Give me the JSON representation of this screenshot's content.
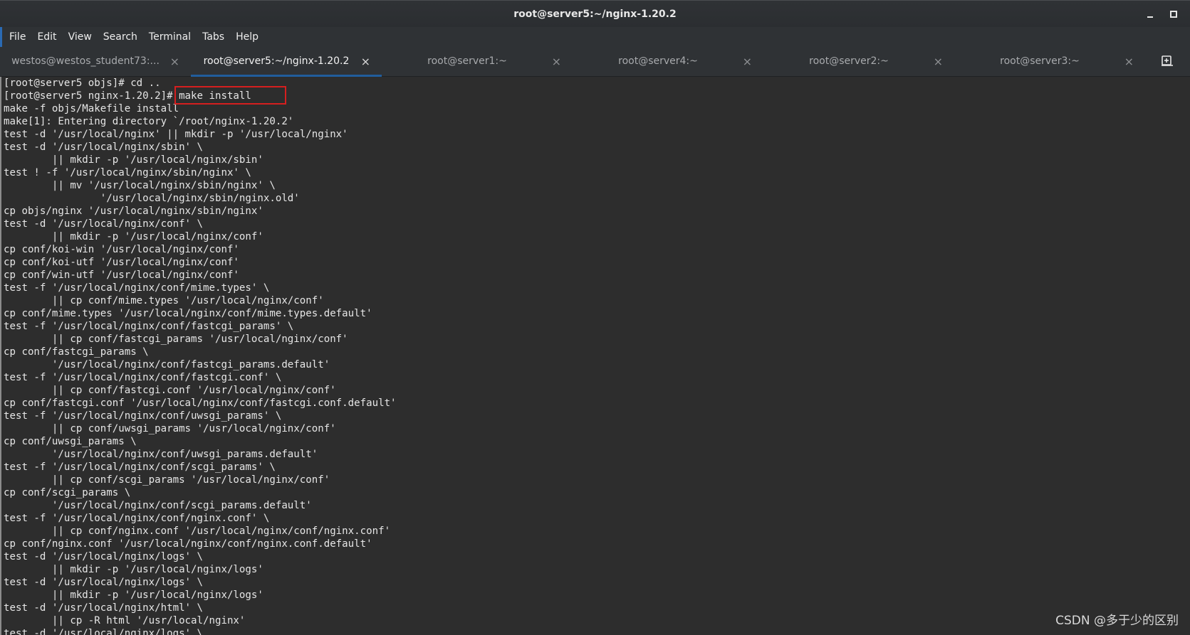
{
  "window": {
    "title": "root@server5:~/nginx-1.20.2"
  },
  "menubar": {
    "items": [
      "File",
      "Edit",
      "View",
      "Search",
      "Terminal",
      "Tabs",
      "Help"
    ]
  },
  "tabs": [
    {
      "label": "westos@westos_student73:...",
      "active": false
    },
    {
      "label": "root@server5:~/nginx-1.20.2",
      "active": true
    },
    {
      "label": "root@server1:~",
      "active": false
    },
    {
      "label": "root@server4:~",
      "active": false
    },
    {
      "label": "root@server2:~",
      "active": false
    },
    {
      "label": "root@server3:~",
      "active": false
    }
  ],
  "tab_close_glyph": "×",
  "terminal": {
    "lines": [
      "[root@server5 objs]# cd ..",
      "[root@server5 nginx-1.20.2]# make install",
      "make -f objs/Makefile install",
      "make[1]: Entering directory `/root/nginx-1.20.2'",
      "test -d '/usr/local/nginx' || mkdir -p '/usr/local/nginx'",
      "test -d '/usr/local/nginx/sbin' \\",
      "        || mkdir -p '/usr/local/nginx/sbin'",
      "test ! -f '/usr/local/nginx/sbin/nginx' \\",
      "        || mv '/usr/local/nginx/sbin/nginx' \\",
      "                '/usr/local/nginx/sbin/nginx.old'",
      "cp objs/nginx '/usr/local/nginx/sbin/nginx'",
      "test -d '/usr/local/nginx/conf' \\",
      "        || mkdir -p '/usr/local/nginx/conf'",
      "cp conf/koi-win '/usr/local/nginx/conf'",
      "cp conf/koi-utf '/usr/local/nginx/conf'",
      "cp conf/win-utf '/usr/local/nginx/conf'",
      "test -f '/usr/local/nginx/conf/mime.types' \\",
      "        || cp conf/mime.types '/usr/local/nginx/conf'",
      "cp conf/mime.types '/usr/local/nginx/conf/mime.types.default'",
      "test -f '/usr/local/nginx/conf/fastcgi_params' \\",
      "        || cp conf/fastcgi_params '/usr/local/nginx/conf'",
      "cp conf/fastcgi_params \\",
      "        '/usr/local/nginx/conf/fastcgi_params.default'",
      "test -f '/usr/local/nginx/conf/fastcgi.conf' \\",
      "        || cp conf/fastcgi.conf '/usr/local/nginx/conf'",
      "cp conf/fastcgi.conf '/usr/local/nginx/conf/fastcgi.conf.default'",
      "test -f '/usr/local/nginx/conf/uwsgi_params' \\",
      "        || cp conf/uwsgi_params '/usr/local/nginx/conf'",
      "cp conf/uwsgi_params \\",
      "        '/usr/local/nginx/conf/uwsgi_params.default'",
      "test -f '/usr/local/nginx/conf/scgi_params' \\",
      "        || cp conf/scgi_params '/usr/local/nginx/conf'",
      "cp conf/scgi_params \\",
      "        '/usr/local/nginx/conf/scgi_params.default'",
      "test -f '/usr/local/nginx/conf/nginx.conf' \\",
      "        || cp conf/nginx.conf '/usr/local/nginx/conf/nginx.conf'",
      "cp conf/nginx.conf '/usr/local/nginx/conf/nginx.conf.default'",
      "test -d '/usr/local/nginx/logs' \\",
      "        || mkdir -p '/usr/local/nginx/logs'",
      "test -d '/usr/local/nginx/logs' \\",
      "        || mkdir -p '/usr/local/nginx/logs'",
      "test -d '/usr/local/nginx/html' \\",
      "        || cp -R html '/usr/local/nginx'",
      "test -d '/usr/local/nginx/logs' \\"
    ]
  },
  "watermark": "CSDN @多于少的区别",
  "colors": {
    "titlebar": "#2f3235",
    "terminal_bg": "#2d2d2d",
    "terminal_fg": "#e6e6e6",
    "active_tab_underline": "#215d9c",
    "highlight_box": "#d61f1f"
  }
}
